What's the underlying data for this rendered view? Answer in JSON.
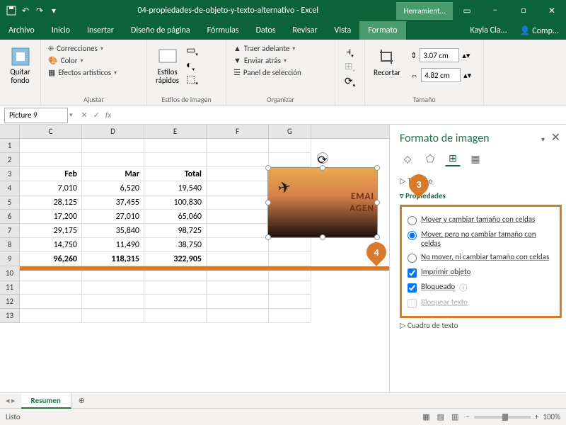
{
  "titlebar": {
    "title": "04-propiedades-de-objeto-y-texto-alternativo - Excel",
    "tools": "Herramient..."
  },
  "menu": {
    "archivo": "Archivo",
    "inicio": "Inicio",
    "insertar": "Insertar",
    "diseno": "Diseño de página",
    "formulas": "Fórmulas",
    "datos": "Datos",
    "revisar": "Revisar",
    "vista": "Vista",
    "formato": "Formato",
    "user": "Kayla Cla...",
    "share": "Comp..."
  },
  "ribbon": {
    "quitar_fondo": "Quitar\nfondo",
    "correcciones": "Correcciones",
    "color": "Color",
    "efectos": "Efectos artísticos",
    "ajustar": "Ajustar",
    "estilos": "Estilos\nrápidos",
    "estilos_grp": "Estilos de imagen",
    "traer": "Traer adelante",
    "enviar": "Enviar atrás",
    "panel": "Panel de selección",
    "organizar": "Organizar",
    "recortar": "Recortar",
    "height": "3.07 cm",
    "width": "4.82 cm",
    "tamano": "Tamaño"
  },
  "namebox": "Picture 9",
  "fx": "fx",
  "cols": [
    "C",
    "D",
    "E",
    "F",
    "G"
  ],
  "rows": [
    "1",
    "2",
    "3",
    "4",
    "5",
    "6",
    "7",
    "8",
    "9",
    "10",
    "11",
    "12",
    "13"
  ],
  "headers": {
    "c": "Feb",
    "d": "Mar",
    "e": "Total"
  },
  "data": [
    {
      "c": "7,010",
      "d": "6,520",
      "e": "19,540"
    },
    {
      "c": "28,125",
      "d": "37,455",
      "e": "100,830"
    },
    {
      "c": "17,200",
      "d": "27,010",
      "e": "65,060"
    },
    {
      "c": "29,175",
      "d": "35,840",
      "e": "98,725"
    },
    {
      "c": "14,750",
      "d": "11,490",
      "e": "38,750"
    }
  ],
  "totals": {
    "c": "96,260",
    "d": "118,315",
    "e": "322,905"
  },
  "img": {
    "line1": "EMAI",
    "line2": "AGEN"
  },
  "pane": {
    "title": "Formato de imagen",
    "s_tamano": "Tamaño",
    "s_props": "Propiedades",
    "s_cuadro": "Cuadro de texto",
    "r1": "Mover y cambiar tamaño con celdas",
    "r2": "Mover, pero no cambiar tamaño con celdas",
    "r3": "No mover, ni cambiar tamaño con celdas",
    "c1": "Imprimir objeto",
    "c2": "Bloqueado",
    "c3": "Bloquear texto"
  },
  "callout3": "3",
  "callout4": "4",
  "sheet": "Resumen",
  "status": "Listo",
  "zoom": "100%"
}
